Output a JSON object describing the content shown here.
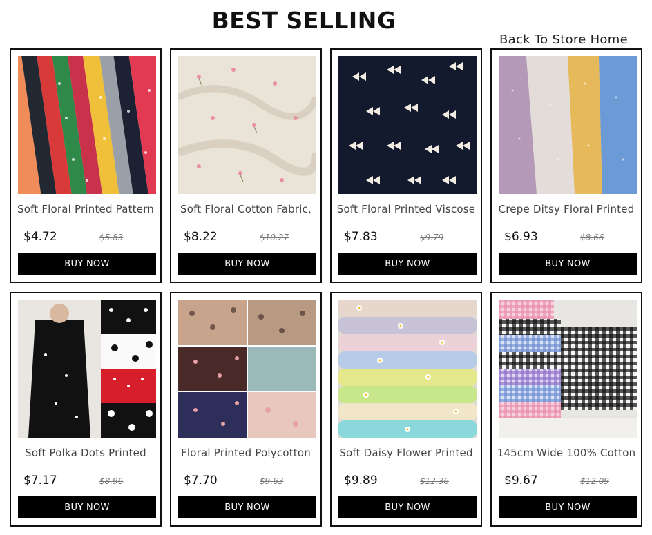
{
  "header": {
    "title": "BEST SELLING",
    "back_link": "Back To Store Home"
  },
  "products": [
    {
      "name": "Soft Floral Printed Pattern",
      "price": "$4.72",
      "old_price": "$5.83",
      "buy_label": "BUY NOW",
      "image": "colorful-floral-fabric-stripes"
    },
    {
      "name": "Soft Floral Cotton Fabric,",
      "price": "$8.22",
      "old_price": "$10.27",
      "buy_label": "BUY NOW",
      "image": "cream-fabric-pink-flowers"
    },
    {
      "name": "Soft Floral Printed Viscose",
      "price": "$7.83",
      "old_price": "$9.79",
      "buy_label": "BUY NOW",
      "image": "navy-fabric-white-bows"
    },
    {
      "name": "Crepe Ditsy Floral Printed",
      "price": "$6.93",
      "old_price": "$8.66",
      "buy_label": "BUY NOW",
      "image": "pastel-crepe-fabrics"
    },
    {
      "name": "Soft Polka Dots Printed",
      "price": "$7.17",
      "old_price": "$8.96",
      "buy_label": "BUY NOW",
      "image": "polka-dot-dress-swatches"
    },
    {
      "name": "Floral Printed Polycotton",
      "price": "$7.70",
      "old_price": "$9.63",
      "buy_label": "BUY NOW",
      "image": "floral-polycotton-grid"
    },
    {
      "name": "Soft Daisy Flower Printed",
      "price": "$9.89",
      "old_price": "$12.36",
      "buy_label": "BUY NOW",
      "image": "stacked-daisy-fabrics"
    },
    {
      "name": "145cm Wide 100% Cotton",
      "price": "$9.67",
      "old_price": "$12.09",
      "buy_label": "BUY NOW",
      "image": "gingham-fabric-stacks"
    }
  ]
}
